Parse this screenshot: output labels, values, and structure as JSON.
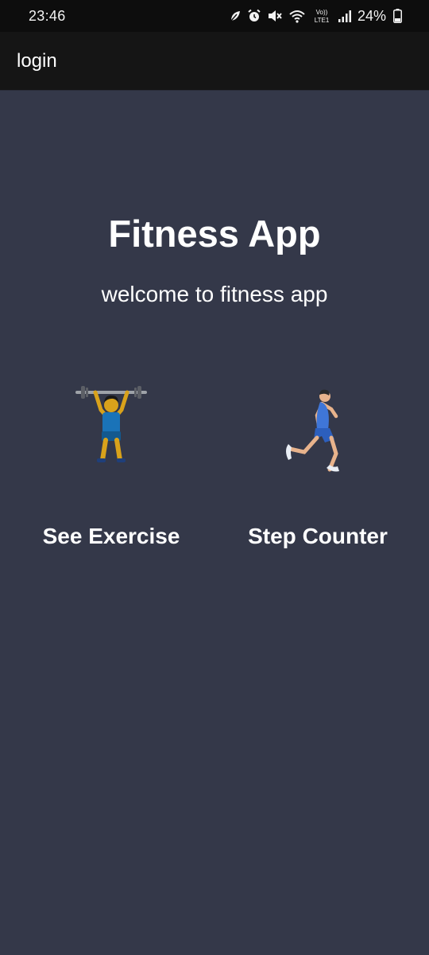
{
  "status_bar": {
    "time": "23:46",
    "battery_text": "24%",
    "icons": [
      "leaf-icon",
      "alarm-icon",
      "mute-icon",
      "wifi-icon",
      "volte-icon",
      "signal-icon",
      "battery-icon"
    ],
    "volte_top": "Vo))",
    "volte_bottom": "LTE1"
  },
  "app_bar": {
    "title": "login"
  },
  "main": {
    "title": "Fitness App",
    "subtitle": "welcome to fitness app",
    "cards": [
      {
        "label": "See Exercise",
        "icon": "weightlifter-icon"
      },
      {
        "label": "Step Counter",
        "icon": "runner-icon"
      }
    ]
  },
  "colors": {
    "background": "#343849",
    "app_bar": "#151515",
    "status_bar": "#0d0d0d",
    "text": "#ffffff"
  }
}
